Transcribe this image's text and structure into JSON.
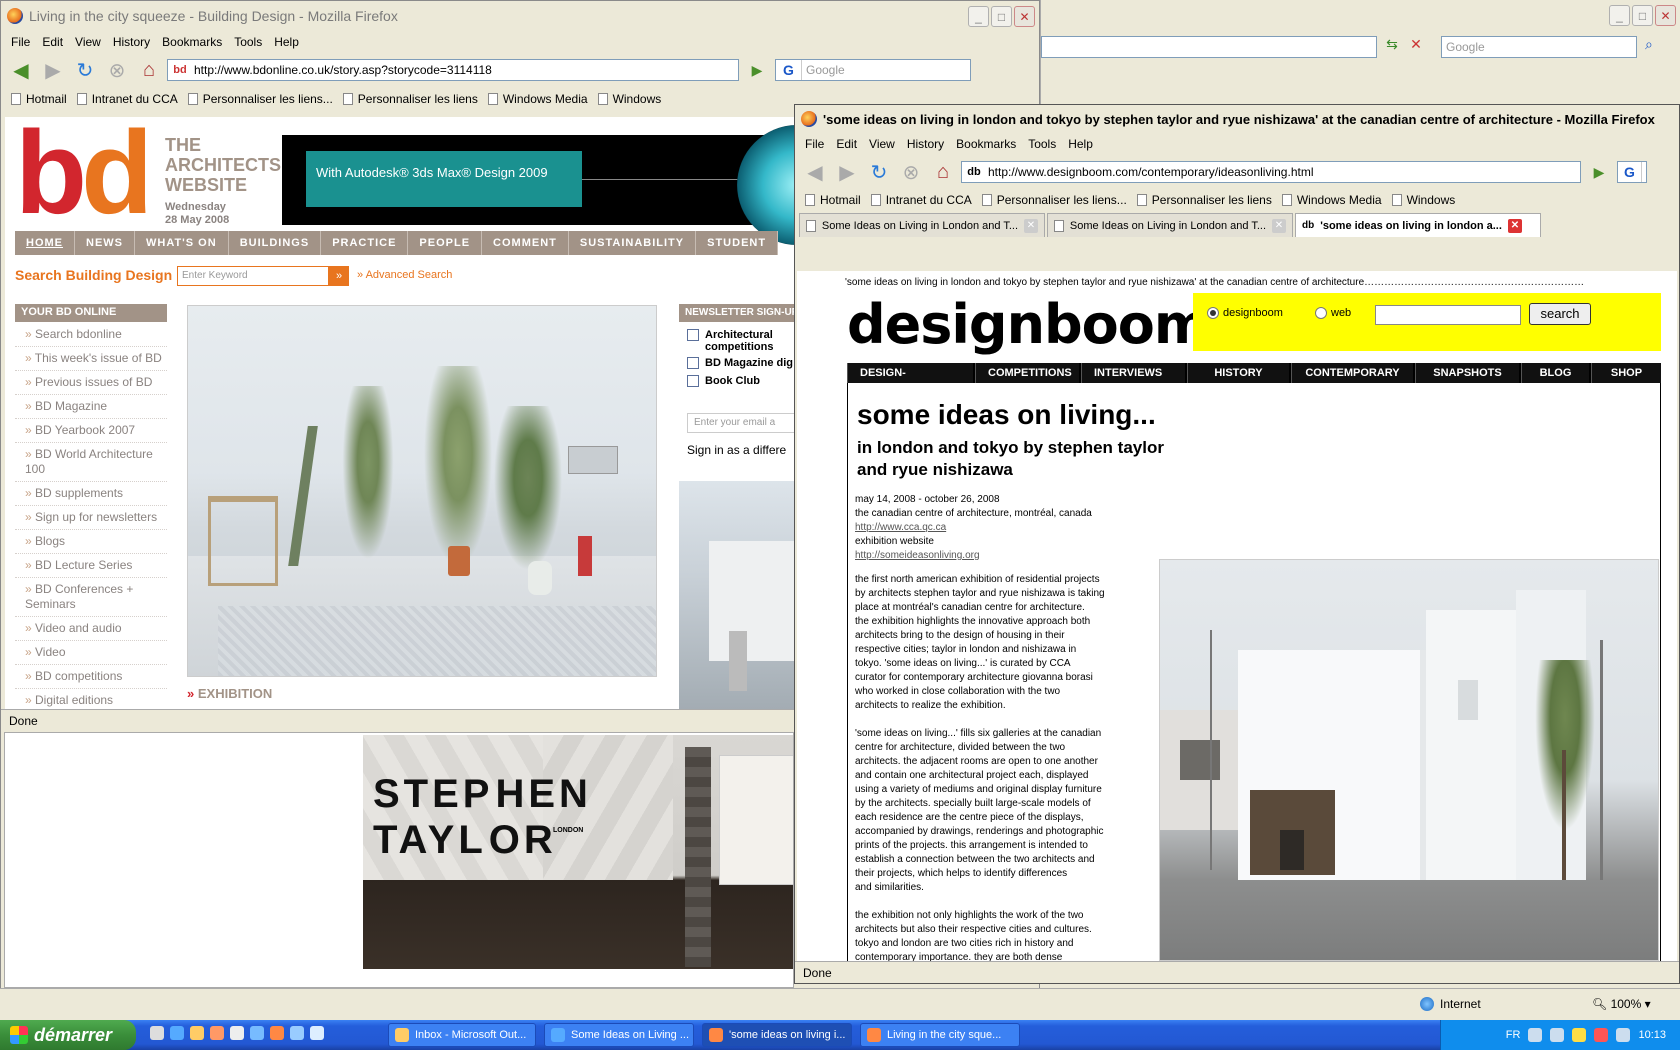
{
  "back_window": {
    "title": "Living in the city squeeze - Building Design - Mozilla Firefox",
    "menu": [
      "File",
      "Edit",
      "View",
      "History",
      "Bookmarks",
      "Tools",
      "Help"
    ],
    "url": "http://www.bdonline.co.uk/story.asp?storycode=3114118",
    "search_placeholder": "Google",
    "bookmarks": [
      "Hotmail",
      "Intranet du CCA",
      "Personnaliser les liens...",
      "Personnaliser les liens",
      "Windows Media",
      "Windows"
    ],
    "status": "Done"
  },
  "right_window_search_placeholder": "Google",
  "bd": {
    "logo_b": "b",
    "logo_d": "d",
    "tagline": [
      "THE",
      "ARCHITECTS'",
      "WEBSITE"
    ],
    "date": [
      "Wednesday",
      "28 May 2008"
    ],
    "ad_text": "With Autodesk® 3ds Max® Design 2009",
    "nav": [
      "HOME",
      "NEWS",
      "WHAT'S ON",
      "BUILDINGS",
      "PRACTICE",
      "PEOPLE",
      "COMMENT",
      "SUSTAINABILITY",
      "STUDENT"
    ],
    "search_label": "Search Building Design",
    "search_placeholder": "Enter Keyword",
    "advanced_search": "Advanced Search",
    "your_bd_title": "YOUR BD ONLINE",
    "your_bd_links": [
      "Search bdonline",
      "This week's issue of BD",
      "Previous issues of BD",
      "BD Magazine",
      "BD Yearbook 2007",
      "BD World Architecture 100",
      "BD supplements",
      "Sign up for newsletters",
      "Blogs",
      "BD Lecture Series",
      "BD Conferences + Seminars",
      "Video and audio",
      "Video",
      "BD competitions",
      "Digital editions"
    ],
    "newsletter_title": "NEWSLETTER SIGN-UP",
    "newsletter_options": [
      "Architectural competitions",
      "BD Magazine dig",
      "Book Club"
    ],
    "email_placeholder": "Enter your email a",
    "sign_in": "Sign in as a differe",
    "exhibition_label": "EXHIBITION",
    "poster_text": [
      "STEP",
      "HEN",
      "TAYL",
      "OR"
    ],
    "poster_small": "LONDON"
  },
  "front_window": {
    "title": "'some ideas on living in london and tokyo by stephen taylor and ryue nishizawa' at the canadian centre of architecture - Mozilla Firefox",
    "menu": [
      "File",
      "Edit",
      "View",
      "History",
      "Bookmarks",
      "Tools",
      "Help"
    ],
    "url": "http://www.designboom.com/contemporary/ideasonliving.html",
    "bookmarks": [
      "Hotmail",
      "Intranet du CCA",
      "Personnaliser les liens...",
      "Personnaliser les liens",
      "Windows Media",
      "Windows"
    ],
    "tabs": [
      "Some Ideas on Living in London and T...",
      "Some Ideas on Living in London and T...",
      "'some ideas on living in london a..."
    ],
    "status": "Done"
  },
  "designboom": {
    "top_caption": "'some ideas on living in london and tokyo by stephen taylor and ryue nishizawa' at the canadian centre of architecture",
    "logo": "designboom",
    "logo_reg": "®",
    "radio_designboom": "designboom",
    "radio_web": "web",
    "search_button": "search",
    "nav": [
      "DESIGN-AEROBICS",
      "COMPETITIONS",
      "INTERVIEWS",
      "HISTORY",
      "CONTEMPORARY",
      "SNAPSHOTS",
      "BLOG",
      "SHOP"
    ],
    "headline": "some ideas on living...",
    "subheadline": "in london and tokyo by stephen taylor and ryue nishizawa",
    "info": [
      "may 14, 2008 - october 26, 2008",
      "the canadian centre of architecture, montréal, canada"
    ],
    "link1": "http://www.cca.qc.ca",
    "exhibition_website": "exhibition website",
    "link2": "http://someideasonliving.org",
    "para1": [
      "the first north american exhibition of residential projects",
      "by architects stephen taylor and ryue nishizawa is taking",
      "place at montréal's canadian centre for architecture.",
      "the exhibition highlights the innovative approach both",
      "architects bring to the design of housing in their",
      "respective cities; taylor in london and nishizawa in",
      "tokyo. 'some ideas on living...' is curated by CCA",
      "curator for contemporary architecture giovanna borasi",
      "who worked in close collaboration with the two",
      "architects to realize the exhibition."
    ],
    "para2": [
      "'some ideas on living...' fills six galleries at the canadian",
      "centre for architecture, divided between the two",
      "architects. the adjacent rooms are open to one another",
      "and contain one architectural project each, displayed",
      "using a variety of mediums and original display furniture",
      "by the architects. specially built large-scale models of",
      "each residence are the centre piece of the displays,",
      "accompanied by drawings, renderings and photographic",
      "prints of the projects. this arrangement is intended to",
      "establish a connection between the two architects and",
      "their projects, which helps to identify differences",
      "and similarities."
    ],
    "para3": [
      "the exhibition not only highlights the work of the two",
      "architects but also their respective cities and cultures.",
      "tokyo and london are two cities rich in history and",
      "contemporary importance. they are both dense"
    ]
  },
  "ie_status": {
    "zone": "Internet",
    "zoom": "100%"
  },
  "taskbar": {
    "start": "démarrer",
    "buttons": [
      "Inbox - Microsoft Out...",
      "Some Ideas on Living ...",
      "'some ideas on living i...",
      "Living in the city sque..."
    ],
    "lang": "FR",
    "clock": "10:13"
  }
}
